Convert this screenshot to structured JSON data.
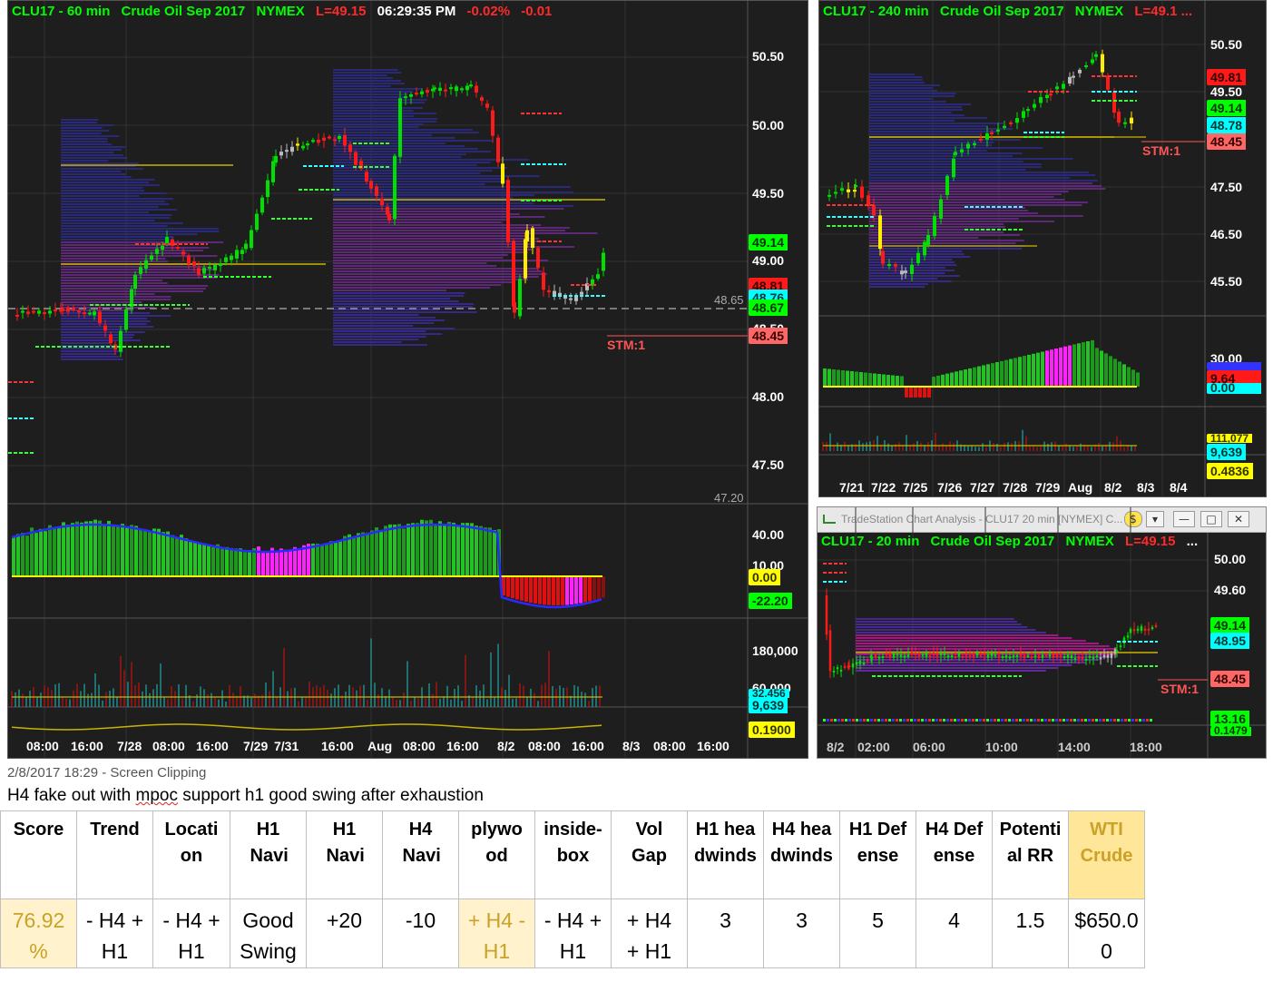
{
  "panel_60": {
    "title": {
      "symbol": "CLU17 - 60 min",
      "name": "Crude Oil Sep 2017",
      "exchange": "NYMEX",
      "last": "L=49.15",
      "time": "06:29:35 PM",
      "pct": "-0.02%",
      "chg": "-0.01"
    },
    "price_axis": [
      "50.50",
      "50.00",
      "49.50",
      "49.00",
      "48.50",
      "48.00",
      "47.50"
    ],
    "price_tags": [
      "49.14",
      "48.81",
      "48.76",
      "48.67",
      "48.45"
    ],
    "ref_labels": [
      "48.65",
      "47.20"
    ],
    "stm": "STM:1",
    "osc_axis": [
      "40.00",
      "10.00"
    ],
    "osc_tags": [
      "0.00",
      "-22.20"
    ],
    "vol_axis": [
      "180,000",
      "60,000"
    ],
    "vol_tags": [
      "32,456",
      "9,639"
    ],
    "bottom_tag": "0.1900",
    "x_labels": [
      "08:00",
      "16:00",
      "7/28",
      "08:00",
      "16:00",
      "7/29",
      "7/31",
      "16:00",
      "Aug",
      "08:00",
      "16:00",
      "8/2",
      "08:00",
      "16:00",
      "8/3",
      "08:00",
      "16:00"
    ]
  },
  "panel_240": {
    "title": {
      "symbol": "CLU17 - 240 min",
      "name": "Crude Oil Sep 2017",
      "exchange": "NYMEX",
      "last": "L=49.1 ..."
    },
    "price_axis": [
      "50.50",
      "49.50",
      "47.50",
      "46.50",
      "45.50"
    ],
    "price_tags": [
      "49.81",
      "49.14",
      "48.78",
      "48.45"
    ],
    "stm": "STM:1",
    "osc_axis": [
      "30.00"
    ],
    "osc_tags": [
      "9.64",
      "0.00"
    ],
    "vol_tags": [
      "111,077",
      "9,639"
    ],
    "bottom_tag": "0.4836",
    "x_labels": [
      "7/21",
      "7/22",
      "7/25",
      "7/26",
      "7/27",
      "7/28",
      "7/29",
      "Aug",
      "8/2",
      "8/3",
      "8/4"
    ]
  },
  "panel_20": {
    "window_title": "TradeStation Chart Analysis - CLU17 20 min [NYMEX] C...",
    "title": {
      "symbol": "CLU17 - 20 min",
      "name": "Crude Oil Sep 2017",
      "exchange": "NYMEX",
      "last": "L=49.15",
      "more": "..."
    },
    "price_axis": [
      "50.00",
      "49.60"
    ],
    "price_tags": [
      "49.14",
      "48.95",
      "48.45"
    ],
    "stm": "STM:1",
    "osc_tags": [
      "13.16",
      "0.1479"
    ],
    "x_labels": [
      "8/2",
      "02:00",
      "06:00",
      "10:00",
      "14:00",
      "18:00"
    ]
  },
  "clipping": {
    "meta": "2/8/2017 18:29 - Screen Clipping",
    "note_before": "H4 fake out with ",
    "note_squig": "mpoc",
    "note_after": " support h1 good swing after exhaustion"
  },
  "table": {
    "headers": [
      "Score",
      "Trend",
      "Location",
      "H1 Navi",
      "H1 Navi",
      "H4 Navi",
      "plywood",
      "inside-box",
      "Vol Gap",
      "H1 headwinds",
      "H4 headwinds",
      "H1 Defense",
      "H4 Defense",
      "Potential RR",
      "WTI Crude"
    ],
    "values": [
      "76.92 %",
      "- H4 + H1",
      "- H4 + H1",
      "Good Swing",
      "+20",
      "-10",
      "+ H4 - H1",
      "- H4 + H1",
      "+ H4 + H1",
      "3",
      "3",
      "5",
      "4",
      "1.5",
      "$650.00"
    ]
  },
  "colors": {
    "bull": "#00e000",
    "bear": "#ff1a1a",
    "neutral": "#bbbbbb",
    "alert": "#ffee00",
    "profile": "#5533aa",
    "panel_bg": "#1e1e1e",
    "gold_header": "#ffe699",
    "gold_cell": "#fff2cc"
  }
}
